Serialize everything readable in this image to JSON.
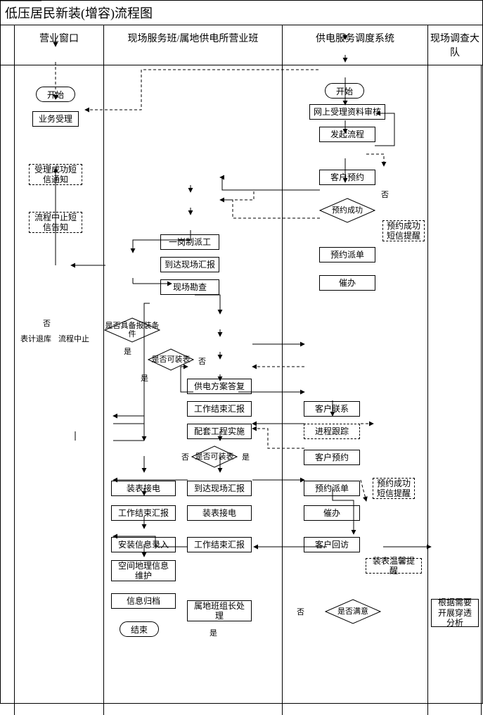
{
  "title": "低压居民新装(增容)流程图",
  "columns": {
    "c1": "",
    "c2": "营业窗口",
    "c3": "现场服务班/属地供电所营业班",
    "c4": "供电服务调度系统",
    "c5": "现场调查大队"
  },
  "lane2": {
    "start": "开始",
    "accept": "业务受理",
    "smsOk": "受理成功短信通知",
    "abortNotice": "流程中止短信告知",
    "returnMeter": "表计退库",
    "abort": "流程中止"
  },
  "lane3": {
    "dispatch": "一岗制派工",
    "arrive": "到达现场汇报",
    "survey": "现场勘查",
    "condDia": "是否具备报装条件",
    "canInstallDia": "是否可装表",
    "plan": "供电方案答复",
    "workEnd": "工作结束汇报",
    "project": "配套工程实施",
    "canInstall2": "是否可装表",
    "install": "装表接电",
    "workEnd2": "工作结束汇报",
    "infoEntry": "安装信息录入",
    "geoMaint": "空间地理信息维护",
    "archive": "信息归档",
    "end": "结束",
    "arrive2": "到达现场汇报",
    "install2": "装表接电",
    "workEnd3": "工作结束汇报",
    "localHandle": "属地班组长处理"
  },
  "lane4": {
    "start": "开始",
    "review": "网上受理资料审核",
    "initiate": "发起流程",
    "book": "客户预约",
    "bookOkDia": "预约成功",
    "bookOkSms": "预约成功短信提醒",
    "bookDispatch": "预约派单",
    "urge": "催办",
    "contact": "客户联系",
    "track": "进程跟踪",
    "book2": "客户预约",
    "bookDispatch2": "预约派单",
    "urge2": "催办",
    "bookOkSms2": "预约成功短信提醒",
    "revisit": "客户回访",
    "warmSms": "装表温馨提醒",
    "satisfyDia": "是否满意"
  },
  "lane5": {
    "analysis": "根据需要开展穿透分析"
  },
  "edgeLabels": {
    "yes": "是",
    "no": "否"
  }
}
